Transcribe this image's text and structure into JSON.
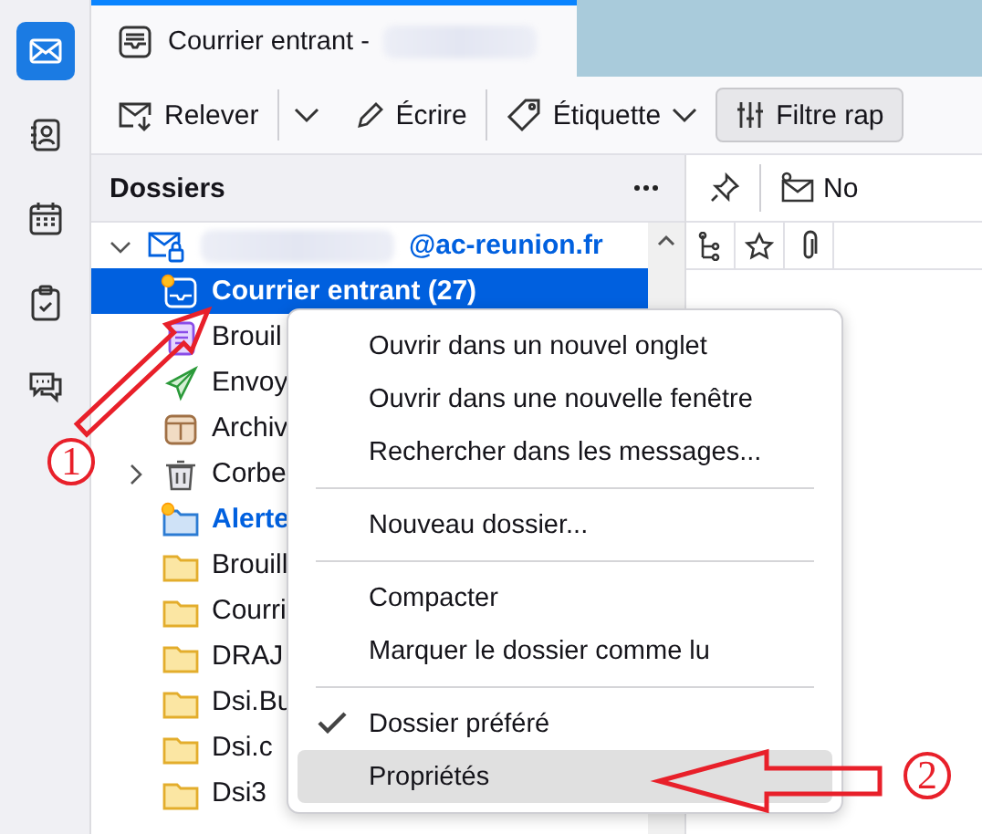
{
  "spaces": [
    {
      "selected": true
    },
    {
      "selected": false
    },
    {
      "selected": false
    },
    {
      "selected": false
    },
    {
      "selected": false
    }
  ],
  "tab": {
    "title": "Courrier entrant -",
    "redacted": true
  },
  "toolbar": {
    "get_messages": "Relever",
    "write": "Écrire",
    "tag": "Étiquette",
    "quick_filter": "Filtre rap"
  },
  "folder_pane": {
    "title": "Dossiers"
  },
  "account": {
    "name": "@ac-reunion.fr",
    "redacted": true,
    "expanded": true
  },
  "folders": [
    {
      "kind": "inbox",
      "name": "Courrier entrant (27)",
      "selected": true,
      "unread": true,
      "new_mail": true
    },
    {
      "kind": "drafts",
      "name": "Brouil",
      "selected": false,
      "unread": false,
      "new_mail": false
    },
    {
      "kind": "sent",
      "name": "Envoy",
      "selected": false,
      "unread": false,
      "new_mail": false
    },
    {
      "kind": "archives",
      "name": "Archiv",
      "selected": false,
      "unread": false,
      "new_mail": false
    },
    {
      "kind": "trash",
      "name": "Corbe",
      "selected": false,
      "unread": false,
      "new_mail": false,
      "expanded": false
    },
    {
      "kind": "alert",
      "name": "Alerte",
      "selected": false,
      "unread": true,
      "new_mail": true
    },
    {
      "kind": "folder",
      "name": "Brouill",
      "selected": false,
      "unread": false,
      "new_mail": false
    },
    {
      "kind": "folder",
      "name": "Courri",
      "selected": false,
      "unread": false,
      "new_mail": false
    },
    {
      "kind": "folder",
      "name": "DRAJ",
      "selected": false,
      "unread": false,
      "new_mail": false
    },
    {
      "kind": "folder",
      "name": "Dsi.Bu",
      "selected": false,
      "unread": false,
      "new_mail": false
    },
    {
      "kind": "folder",
      "name": "Dsi.c",
      "selected": false,
      "unread": false,
      "new_mail": false
    },
    {
      "kind": "folder",
      "name": "Dsi3",
      "selected": false,
      "unread": false,
      "new_mail": false
    }
  ],
  "message_pane": {
    "column_label": "No"
  },
  "context_menu": {
    "items": [
      {
        "kind": "item",
        "label": "Ouvrir dans un nouvel onglet",
        "checked": false,
        "selected": false
      },
      {
        "kind": "item",
        "label": "Ouvrir dans une nouvelle fenêtre",
        "checked": false,
        "selected": false
      },
      {
        "kind": "item",
        "label": "Rechercher dans les messages...",
        "checked": false,
        "selected": false
      },
      {
        "kind": "separator"
      },
      {
        "kind": "item",
        "label": "Nouveau dossier...",
        "checked": false,
        "selected": false
      },
      {
        "kind": "separator"
      },
      {
        "kind": "item",
        "label": "Compacter",
        "checked": false,
        "selected": false
      },
      {
        "kind": "item",
        "label": "Marquer le dossier comme lu",
        "checked": false,
        "selected": false
      },
      {
        "kind": "separator"
      },
      {
        "kind": "item",
        "label": "Dossier préféré",
        "checked": true,
        "selected": false
      },
      {
        "kind": "item",
        "label": "Propriétés",
        "checked": false,
        "selected": true
      }
    ]
  },
  "annotations": [
    {
      "label": "1"
    },
    {
      "label": "2"
    }
  ]
}
